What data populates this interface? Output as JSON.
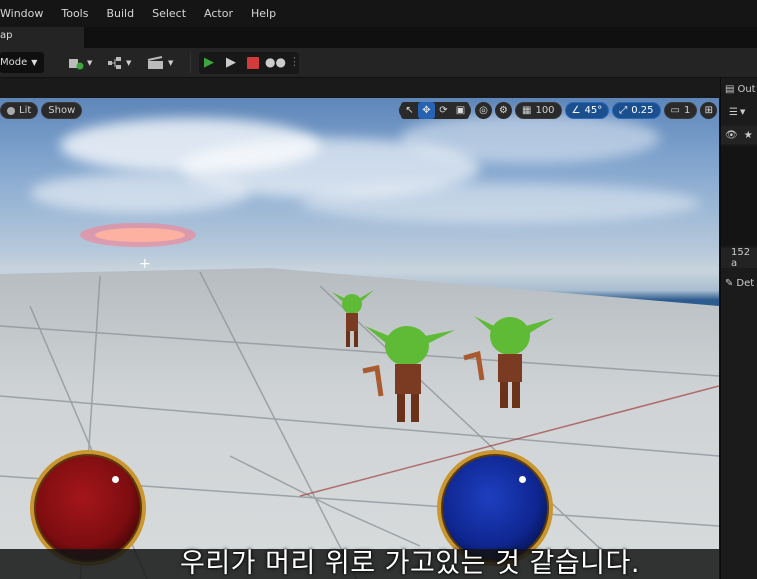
{
  "menubar": {
    "items": [
      "Window",
      "Tools",
      "Build",
      "Select",
      "Actor",
      "Help"
    ]
  },
  "tab": {
    "label": "ap"
  },
  "toolbar": {
    "mode_label": "Mode",
    "play_color": "#3fa63f",
    "stop_color": "#d13b3b"
  },
  "viewport": {
    "lit_label": "Lit",
    "show_label": "Show",
    "grid_value": "100",
    "angle_value": "45°",
    "scale_value": "0.25",
    "camera_speed": "1"
  },
  "subtitle": {
    "text": "우리가 머리 위로 가고있는 것 같습니다."
  },
  "right_panel": {
    "outliner_label": "Out",
    "count_text": "152 a",
    "details_label": "Det"
  }
}
